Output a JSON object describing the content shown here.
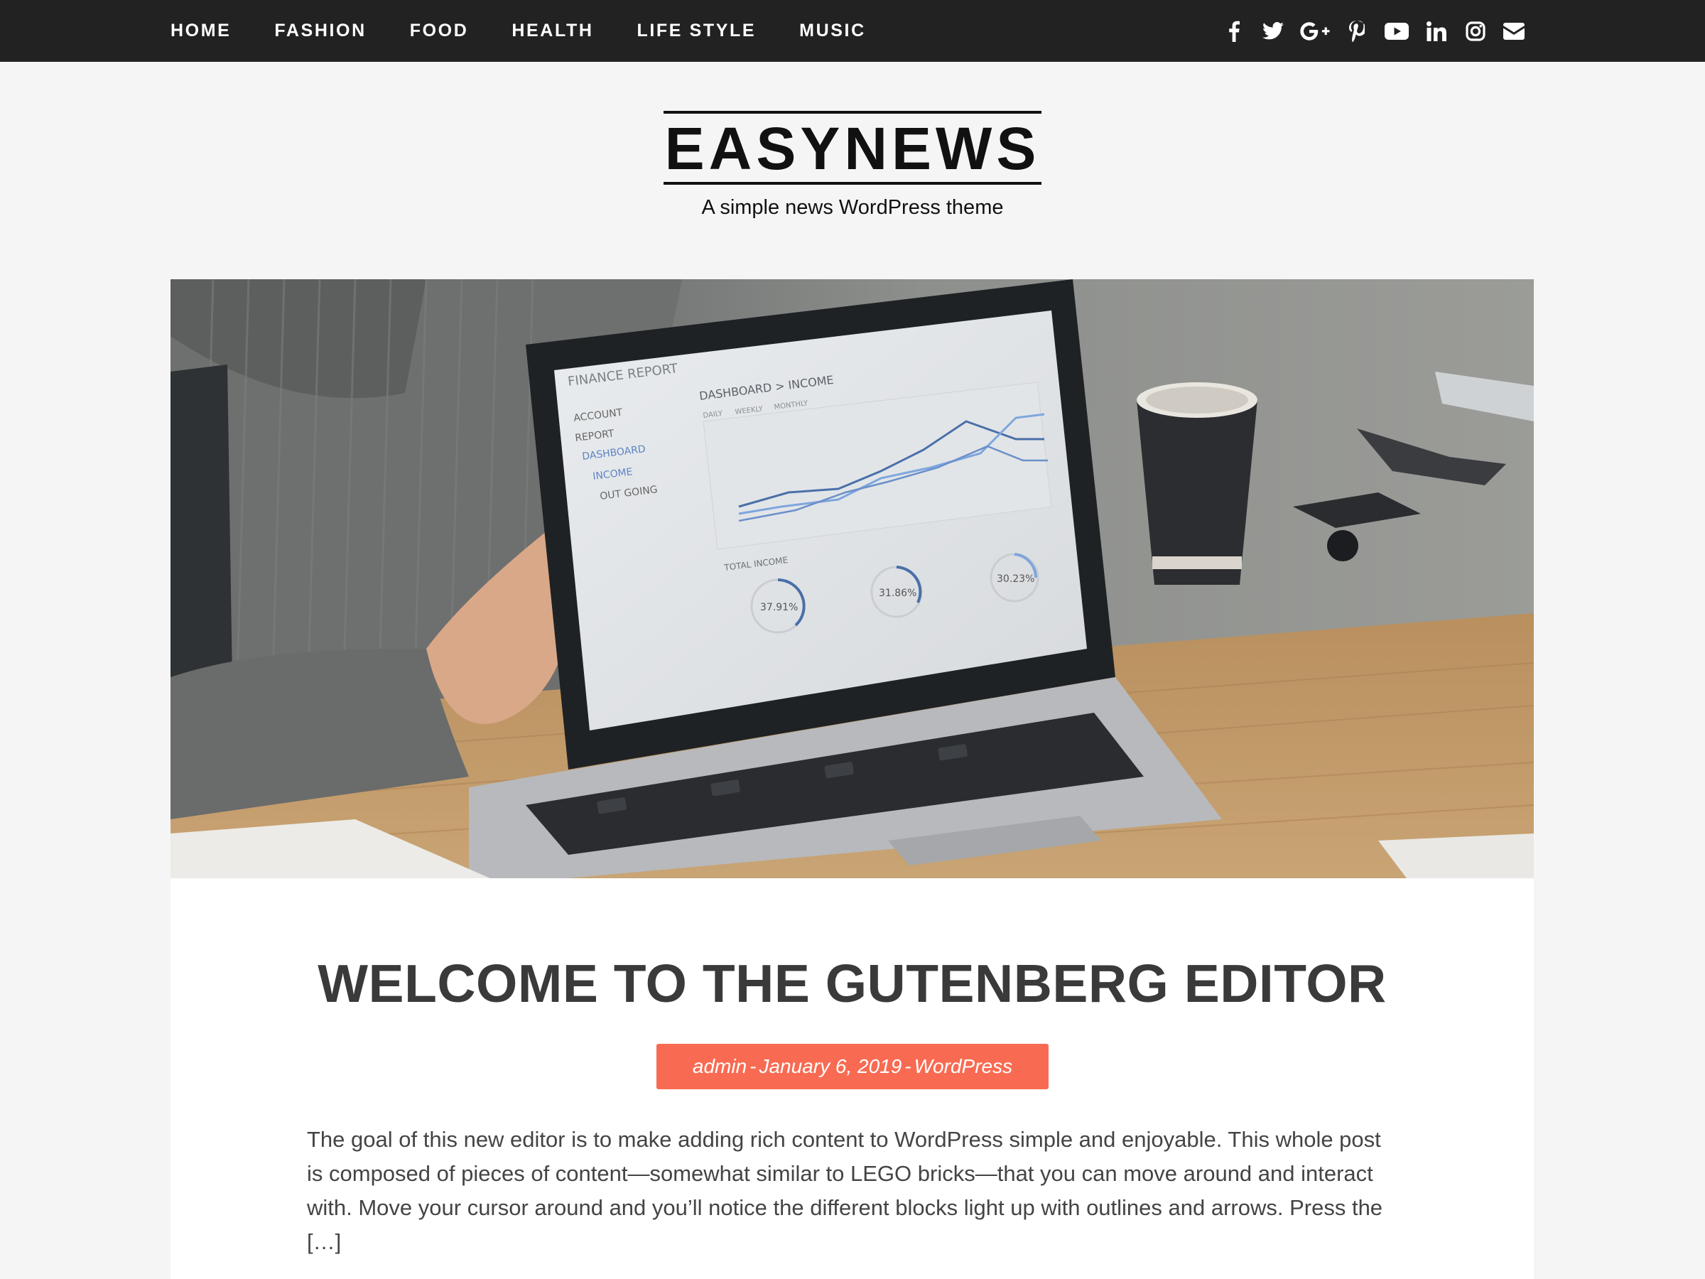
{
  "nav": {
    "items": [
      {
        "label": "HOME"
      },
      {
        "label": "FASHION"
      },
      {
        "label": "FOOD"
      },
      {
        "label": "HEALTH"
      },
      {
        "label": "LIFE STYLE"
      },
      {
        "label": "MUSIC"
      }
    ]
  },
  "social": [
    "facebook-icon",
    "twitter-icon",
    "google-plus-icon",
    "pinterest-icon",
    "youtube-icon",
    "linkedin-icon",
    "instagram-icon",
    "email-icon"
  ],
  "site": {
    "logo": "EASYNEWS",
    "tagline": "A simple news WordPress theme"
  },
  "hero": {
    "screen_title": "FINANCE REPORT",
    "breadcrumb": "DASHBOARD > INCOME",
    "tabs": [
      "DAILY",
      "WEEKLY",
      "MONTHLY"
    ],
    "menu": [
      "ACCOUNT",
      "REPORT",
      "DASHBOARD",
      "INCOME",
      "OUT GOING"
    ],
    "section_label": "TOTAL INCOME",
    "gauges": [
      "37.91%",
      "31.86%",
      "30.23%"
    ]
  },
  "post": {
    "title": "WELCOME TO THE GUTENBERG EDITOR",
    "author": "admin",
    "date": "January 6, 2019",
    "category": "WordPress",
    "separator": "-",
    "excerpt": "The goal of this new editor is to make adding rich content to WordPress simple and enjoyable. This whole post is composed of pieces of content—somewhat similar to LEGO bricks—that you can move around and interact with. Move your cursor around and you’ll notice the different blocks light up with outlines and arrows. Press the […]"
  },
  "colors": {
    "topbar": "#222222",
    "accent": "#f86b52",
    "background": "#f5f5f5"
  }
}
